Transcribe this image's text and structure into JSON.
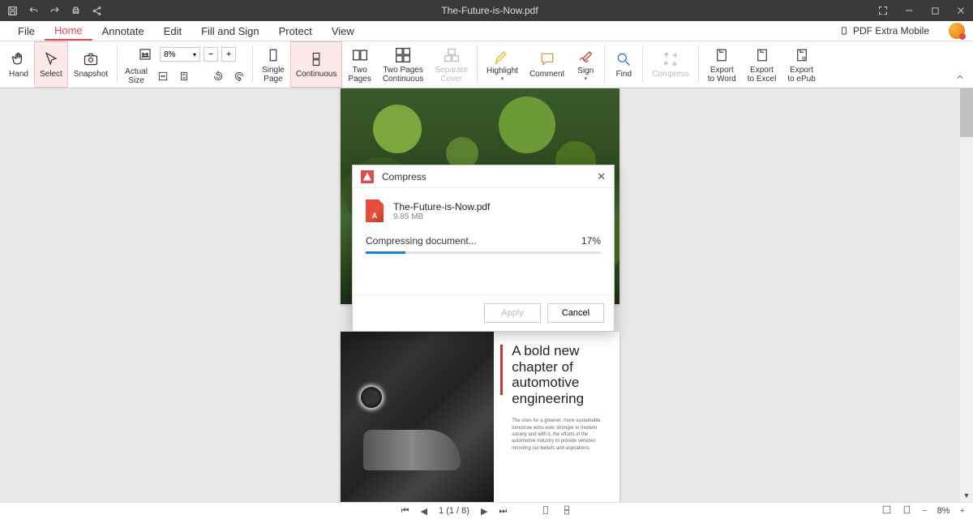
{
  "titlebar": {
    "title": "The-Future-is-Now.pdf"
  },
  "menu": {
    "items": [
      "File",
      "Home",
      "Annotate",
      "Edit",
      "Fill and Sign",
      "Protect",
      "View"
    ],
    "active_index": 1,
    "mobile_label": "PDF Extra Mobile"
  },
  "ribbon": {
    "hand": "Hand",
    "select": "Select",
    "snapshot": "Snapshot",
    "actual_size": "Actual\nSize",
    "zoom_value": "8%",
    "single_page": "Single\nPage",
    "continuous": "Continuous",
    "two_pages": "Two\nPages",
    "two_pages_cont": "Two Pages\nContinuous",
    "separate_cover": "Separate\nCover",
    "highlight": "Highlight",
    "comment": "Comment",
    "sign": "Sign",
    "find": "Find",
    "compress": "Compress",
    "export_word": "Export\nto Word",
    "export_excel": "Export\nto Excel",
    "export_epub": "Export\nto ePub"
  },
  "dialog": {
    "title": "Compress",
    "file_name": "The-Future-is-Now.pdf",
    "file_size": "9.85 MB",
    "status": "Compressing document...",
    "percent": "17%",
    "apply": "Apply",
    "cancel": "Cancel"
  },
  "article": {
    "heading": "A bold new chapter of automotive engineering",
    "body": "The cries for a greener, more sustainable tomorrow echo ever stronger in modern society and with it, the efforts of the automotive industry to provide vehicles mirroring our beliefs and aspirations."
  },
  "status": {
    "page_label": "1 (1 / 8)",
    "zoom": "8%"
  }
}
